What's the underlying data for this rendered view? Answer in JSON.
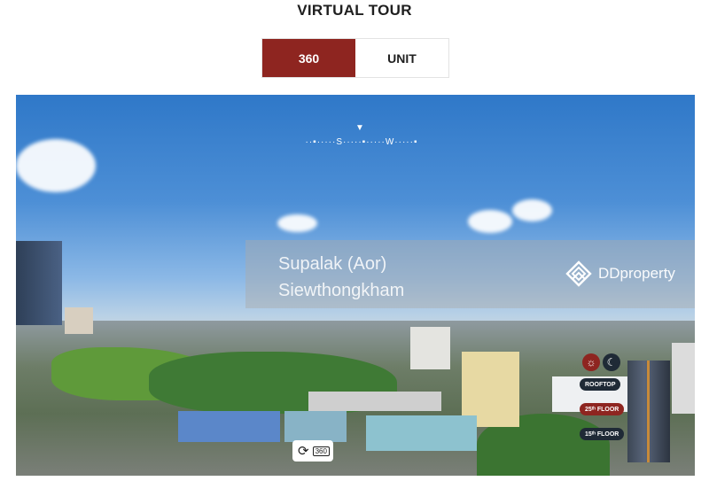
{
  "page": {
    "title": "VIRTUAL TOUR"
  },
  "tabs": [
    {
      "label": "360",
      "active": true
    },
    {
      "label": "UNIT",
      "active": false
    }
  ],
  "viewer": {
    "compass": {
      "marker": "▼",
      "scale": "··▪·····S·····▪·····W·····▪"
    },
    "watermark": {
      "line1": "Supalak (Aor)",
      "line2": "Siewthongkham",
      "logo_text": "DDproperty",
      "logo_icon": "ddproperty-logo-icon"
    },
    "mode_toggle": {
      "day_icon": "sun-icon",
      "night_icon": "moon-icon",
      "active": "day"
    },
    "floors": [
      {
        "label": "ROOFTOP",
        "active": false
      },
      {
        "label": "25ᵗʰ FLOOR",
        "active": true
      },
      {
        "label": "15ᵗʰ FLOOR",
        "active": false
      }
    ],
    "rotate_control": {
      "icon": "rotate-icon",
      "label": "360"
    }
  },
  "colors": {
    "accent": "#8e2520",
    "dark": "#1f2a36"
  }
}
